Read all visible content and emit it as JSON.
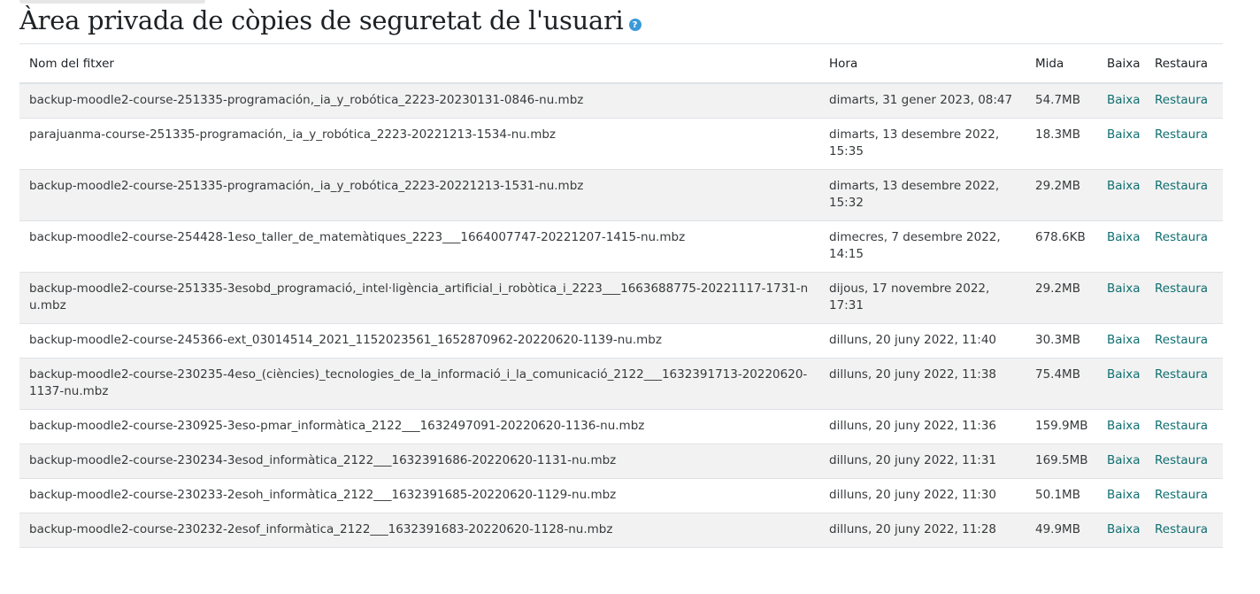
{
  "page": {
    "title": "Àrea privada de còpies de seguretat de l'usuari",
    "help_icon": "question-icon"
  },
  "table": {
    "headers": {
      "name": "Nom del fitxer",
      "time": "Hora",
      "size": "Mida",
      "download": "Baixa",
      "restore": "Restaura"
    },
    "rows": [
      {
        "name": "backup-moodle2-course-251335-programación,_ia_y_robótica_2223-20230131-0846-nu.mbz",
        "time": "dimarts, 31 gener 2023, 08:47",
        "size": "54.7MB",
        "download": "Baixa",
        "restore": "Restaura"
      },
      {
        "name": "parajuanma-course-251335-programación,_ia_y_robótica_2223-20221213-1534-nu.mbz",
        "time": "dimarts, 13 desembre 2022, 15:35",
        "size": "18.3MB",
        "download": "Baixa",
        "restore": "Restaura"
      },
      {
        "name": "backup-moodle2-course-251335-programación,_ia_y_robótica_2223-20221213-1531-nu.mbz",
        "time": "dimarts, 13 desembre 2022, 15:32",
        "size": "29.2MB",
        "download": "Baixa",
        "restore": "Restaura"
      },
      {
        "name": "backup-moodle2-course-254428-1eso_taller_de_matemàtiques_2223___1664007747-20221207-1415-nu.mbz",
        "time": "dimecres, 7 desembre 2022, 14:15",
        "size": "678.6KB",
        "download": "Baixa",
        "restore": "Restaura"
      },
      {
        "name": "backup-moodle2-course-251335-3esobd_programació,_intel·ligència_artificial_i_robòtica_i_2223___1663688775-20221117-1731-nu.mbz",
        "time": "dijous, 17 novembre 2022, 17:31",
        "size": "29.2MB",
        "download": "Baixa",
        "restore": "Restaura"
      },
      {
        "name": "backup-moodle2-course-245366-ext_03014514_2021_1152023561_1652870962-20220620-1139-nu.mbz",
        "time": "dilluns, 20 juny 2022, 11:40",
        "size": "30.3MB",
        "download": "Baixa",
        "restore": "Restaura"
      },
      {
        "name": "backup-moodle2-course-230235-4eso_(ciències)_tecnologies_de_la_informació_i_la_comunicació_2122___1632391713-20220620-1137-nu.mbz",
        "time": "dilluns, 20 juny 2022, 11:38",
        "size": "75.4MB",
        "download": "Baixa",
        "restore": "Restaura"
      },
      {
        "name": "backup-moodle2-course-230925-3eso-pmar_informàtica_2122___1632497091-20220620-1136-nu.mbz",
        "time": "dilluns, 20 juny 2022, 11:36",
        "size": "159.9MB",
        "download": "Baixa",
        "restore": "Restaura"
      },
      {
        "name": "backup-moodle2-course-230234-3esod_informàtica_2122___1632391686-20220620-1131-nu.mbz",
        "time": "dilluns, 20 juny 2022, 11:31",
        "size": "169.5MB",
        "download": "Baixa",
        "restore": "Restaura"
      },
      {
        "name": "backup-moodle2-course-230233-2esoh_informàtica_2122___1632391685-20220620-1129-nu.mbz",
        "time": "dilluns, 20 juny 2022, 11:30",
        "size": "50.1MB",
        "download": "Baixa",
        "restore": "Restaura"
      },
      {
        "name": "backup-moodle2-course-230232-2esof_informàtica_2122___1632391683-20220620-1128-nu.mbz",
        "time": "dilluns, 20 juny 2022, 11:28",
        "size": "49.9MB",
        "download": "Baixa",
        "restore": "Restaura"
      }
    ]
  },
  "colors": {
    "link": "#0f6e70",
    "stripe": "#f2f2f2",
    "help_icon": "#3a9ad9"
  }
}
